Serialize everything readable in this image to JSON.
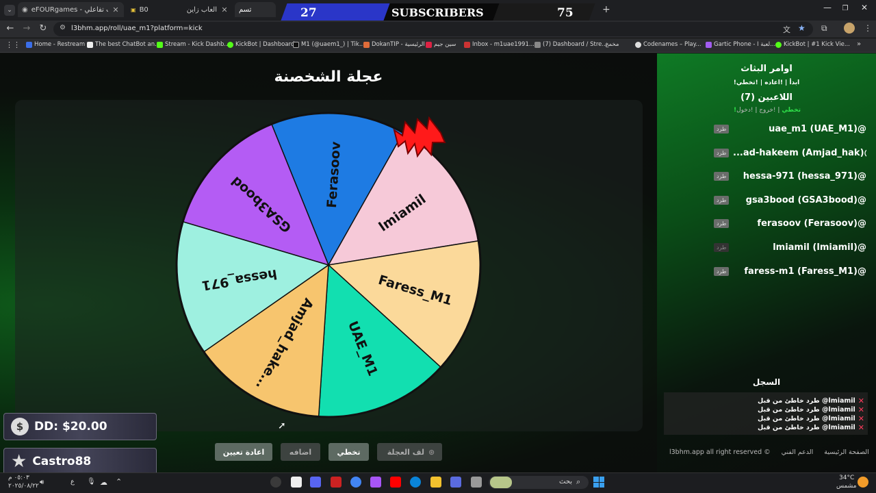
{
  "browser": {
    "tabs": [
      {
        "title": "eFOURgames - تابع ألعاب تفاعلي"
      },
      {
        "title": "B0"
      },
      {
        "title": "العاب زاين"
      },
      {
        "title": "تسم"
      }
    ],
    "url": "l3bhm.app/roll/uae_m1?platform=kick",
    "bookmarks": [
      "Home - Restream",
      "The best ChatBot an...",
      "Stream - Kick Dashb...",
      "KickBot | Dashboard",
      "M1 (@uaem1_) | Tik...",
      "DokanTIP - الرئيسية",
      "سين جيم",
      "Inbox - m1uae1991...",
      "(7) Dashboard / Stre...",
      "مخمخ",
      "Codenames – Play...",
      "Gartic Phone - لعبة ا...",
      "KickBot | #1 Kick Vie..."
    ]
  },
  "overlay": {
    "sub_count_left": "27",
    "subscribers_label": "SUBSCRIBERS",
    "sub_count_right": "75",
    "donation": "DD: $20.00",
    "top_name": "Castro88"
  },
  "game": {
    "title": "عجلة الشخصنة",
    "wheel_slices": [
      {
        "name": "Ferasoov",
        "color": "#1e7be3"
      },
      {
        "name": "lmiamil",
        "color": "#f6c9d8"
      },
      {
        "name": "Faress_M1",
        "color": "#fbd99a"
      },
      {
        "name": "UAE_M1",
        "color": "#12dfb0"
      },
      {
        "name": "Amjad_hake...",
        "color": "#f7c56e"
      },
      {
        "name": "hessa_971",
        "color": "#9ef0e0"
      },
      {
        "name": "GSA3bood",
        "color": "#b45cf4"
      }
    ],
    "buttons": {
      "spin": "لف العجلة",
      "skip": "تخطي",
      "add": "اضافه",
      "reset": "اعادة تعيين"
    }
  },
  "sidebar": {
    "commands_title": "اوامر البثاث",
    "commands": "!ابدأ | !اعاده | !تخطي",
    "players_title": "اللاعبين (7)",
    "players_cmds": {
      "enter": "!دخول",
      "exit": "!خروج",
      "skip": "!تخطي"
    },
    "kick_label": "طرد",
    "players": [
      "uae_m1 (UAE_M1)@",
      "...ad-hakeem (Amjad_hak)@",
      "hessa-971 (hessa_971)@",
      "gsa3bood (GSA3bood)@",
      "ferasoov (Ferasoov)@",
      "lmiamil (lmiamil)@",
      "faress-m1 (Faress_M1)@"
    ],
    "log_title": "السجل",
    "log": [
      "طرد خاطئ من قبل @lmiamil",
      "طرد خاطئ من قبل @lmiamil",
      "طرد خاطئ من قبل @lmiamil",
      "طرد خاطئ من قبل @lmiamil"
    ],
    "footer": {
      "home": "الصفحة الرئيسية",
      "support": "الدعم الفني",
      "rights": "l3bhm.app all right reserved ©"
    }
  },
  "taskbar": {
    "time": "٠٥:٠٣ م",
    "date": "٢٠٢٥/٠٨/٢٢",
    "lang": "ع",
    "search": "بحث",
    "weather_temp": "34°C",
    "weather_desc": "مشمس"
  }
}
